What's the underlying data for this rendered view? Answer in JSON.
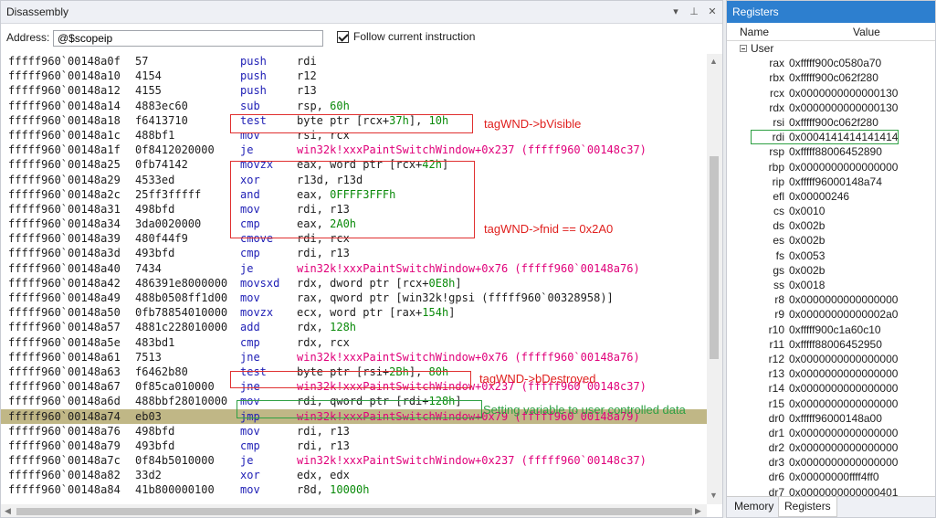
{
  "disassembly": {
    "title": "Disassembly",
    "address_label": "Address:",
    "address_value": "@$scopeip",
    "follow_label": "Follow current instruction",
    "lines": [
      {
        "addr": "fffff960`00148a0f",
        "bytes": "57",
        "mn": "push",
        "op": "rdi"
      },
      {
        "addr": "fffff960`00148a10",
        "bytes": "4154",
        "mn": "push",
        "op": "r12"
      },
      {
        "addr": "fffff960`00148a12",
        "bytes": "4155",
        "mn": "push",
        "op": "r13"
      },
      {
        "addr": "fffff960`00148a14",
        "bytes": "4883ec60",
        "mn": "sub",
        "op": "rsp, 60h"
      },
      {
        "addr": "fffff960`00148a18",
        "bytes": "f6413710",
        "mn": "test",
        "op": "byte ptr [rcx+37h], 10h"
      },
      {
        "addr": "fffff960`00148a1c",
        "bytes": "488bf1",
        "mn": "mov",
        "op": "rsi, rcx"
      },
      {
        "addr": "fffff960`00148a1f",
        "bytes": "0f8412020000",
        "mn": "je",
        "op": "win32k!xxxPaintSwitchWindow+0x237 (fffff960`00148c37)",
        "sym": true
      },
      {
        "addr": "fffff960`00148a25",
        "bytes": "0fb74142",
        "mn": "movzx",
        "op": "eax, word ptr [rcx+42h]"
      },
      {
        "addr": "fffff960`00148a29",
        "bytes": "4533ed",
        "mn": "xor",
        "op": "r13d, r13d"
      },
      {
        "addr": "fffff960`00148a2c",
        "bytes": "25ff3fffff",
        "mn": "and",
        "op": "eax, 0FFFF3FFFh"
      },
      {
        "addr": "fffff960`00148a31",
        "bytes": "498bfd",
        "mn": "mov",
        "op": "rdi, r13"
      },
      {
        "addr": "fffff960`00148a34",
        "bytes": "3da0020000",
        "mn": "cmp",
        "op": "eax, 2A0h"
      },
      {
        "addr": "fffff960`00148a39",
        "bytes": "480f44f9",
        "mn": "cmove",
        "op": "rdi, rcx"
      },
      {
        "addr": "fffff960`00148a3d",
        "bytes": "493bfd",
        "mn": "cmp",
        "op": "rdi, r13"
      },
      {
        "addr": "fffff960`00148a40",
        "bytes": "7434",
        "mn": "je",
        "op": "win32k!xxxPaintSwitchWindow+0x76 (fffff960`00148a76)",
        "sym": true
      },
      {
        "addr": "fffff960`00148a42",
        "bytes": "486391e8000000",
        "mn": "movsxd",
        "op": "rdx, dword ptr [rcx+0E8h]"
      },
      {
        "addr": "fffff960`00148a49",
        "bytes": "488b0508ff1d00",
        "mn": "mov",
        "op": "rax, qword ptr [win32k!gpsi (fffff960`00328958)]"
      },
      {
        "addr": "fffff960`00148a50",
        "bytes": "0fb78854010000",
        "mn": "movzx",
        "op": "ecx, word ptr [rax+154h]"
      },
      {
        "addr": "fffff960`00148a57",
        "bytes": "4881c228010000",
        "mn": "add",
        "op": "rdx, 128h"
      },
      {
        "addr": "fffff960`00148a5e",
        "bytes": "483bd1",
        "mn": "cmp",
        "op": "rdx, rcx"
      },
      {
        "addr": "fffff960`00148a61",
        "bytes": "7513",
        "mn": "jne",
        "op": "win32k!xxxPaintSwitchWindow+0x76 (fffff960`00148a76)",
        "sym": true
      },
      {
        "addr": "fffff960`00148a63",
        "bytes": "f6462b80",
        "mn": "test",
        "op": "byte ptr [rsi+2Bh], 80h"
      },
      {
        "addr": "fffff960`00148a67",
        "bytes": "0f85ca010000",
        "mn": "jne",
        "op": "win32k!xxxPaintSwitchWindow+0x237 (fffff960`00148c37)",
        "sym": true
      },
      {
        "addr": "fffff960`00148a6d",
        "bytes": "488bbf28010000",
        "mn": "mov",
        "op": "rdi, qword ptr [rdi+128h]"
      },
      {
        "addr": "fffff960`00148a74",
        "bytes": "eb03",
        "mn": "jmp",
        "op": "win32k!xxxPaintSwitchWindow+0x79 (fffff960`00148a79)",
        "sym": true,
        "current": true
      },
      {
        "addr": "fffff960`00148a76",
        "bytes": "498bfd",
        "mn": "mov",
        "op": "rdi, r13"
      },
      {
        "addr": "fffff960`00148a79",
        "bytes": "493bfd",
        "mn": "cmp",
        "op": "rdi, r13"
      },
      {
        "addr": "fffff960`00148a7c",
        "bytes": "0f84b5010000",
        "mn": "je",
        "op": "win32k!xxxPaintSwitchWindow+0x237 (fffff960`00148c37)",
        "sym": true
      },
      {
        "addr": "fffff960`00148a82",
        "bytes": "33d2",
        "mn": "xor",
        "op": "edx, edx"
      },
      {
        "addr": "fffff960`00148a84",
        "bytes": "41b800000100",
        "mn": "mov",
        "op": "r8d, 10000h"
      }
    ],
    "annotations": {
      "visible": "tagWND->bVisible",
      "fnid": "tagWND->fnid == 0x2A0",
      "destroyed": "tagWND->bDestroyed",
      "user_data": "Setting variable to user controlled data"
    }
  },
  "registers": {
    "title": "Registers",
    "col_name": "Name",
    "col_value": "Value",
    "group": "User",
    "items": [
      {
        "name": "rax",
        "value": "0xfffff900c0580a70"
      },
      {
        "name": "rbx",
        "value": "0xfffff900c062f280"
      },
      {
        "name": "rcx",
        "value": "0x0000000000000130"
      },
      {
        "name": "rdx",
        "value": "0x0000000000000130"
      },
      {
        "name": "rsi",
        "value": "0xfffff900c062f280"
      },
      {
        "name": "rdi",
        "value": "0x0004141414141414"
      },
      {
        "name": "rsp",
        "value": "0xfffff88006452890"
      },
      {
        "name": "rbp",
        "value": "0x0000000000000000"
      },
      {
        "name": "rip",
        "value": "0xfffff96000148a74"
      },
      {
        "name": "efl",
        "value": "0x00000246"
      },
      {
        "name": "cs",
        "value": "0x0010"
      },
      {
        "name": "ds",
        "value": "0x002b"
      },
      {
        "name": "es",
        "value": "0x002b"
      },
      {
        "name": "fs",
        "value": "0x0053"
      },
      {
        "name": "gs",
        "value": "0x002b"
      },
      {
        "name": "ss",
        "value": "0x0018"
      },
      {
        "name": "r8",
        "value": "0x0000000000000000"
      },
      {
        "name": "r9",
        "value": "0x00000000000002a0"
      },
      {
        "name": "r10",
        "value": "0xfffff900c1a60c10"
      },
      {
        "name": "r11",
        "value": "0xfffff88006452950"
      },
      {
        "name": "r12",
        "value": "0x0000000000000000"
      },
      {
        "name": "r13",
        "value": "0x0000000000000000"
      },
      {
        "name": "r14",
        "value": "0x0000000000000000"
      },
      {
        "name": "r15",
        "value": "0x0000000000000000"
      },
      {
        "name": "dr0",
        "value": "0xfffff96000148a00"
      },
      {
        "name": "dr1",
        "value": "0x0000000000000000"
      },
      {
        "name": "dr2",
        "value": "0x0000000000000000"
      },
      {
        "name": "dr3",
        "value": "0x0000000000000000"
      },
      {
        "name": "dr6",
        "value": "0x00000000ffff4ff0"
      },
      {
        "name": "dr7",
        "value": "0x0000000000000401"
      }
    ],
    "tabs": [
      "Memory",
      "Registers"
    ]
  }
}
